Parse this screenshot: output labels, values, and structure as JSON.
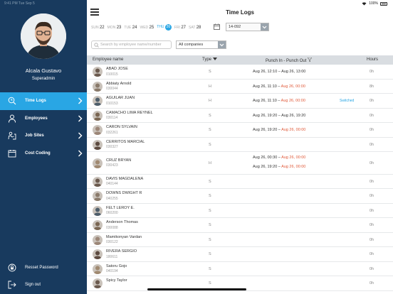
{
  "status_bar": {
    "time": "9:41 PM Tue Sep 5",
    "battery": "100%"
  },
  "user": {
    "name": "Alcala Gustavo",
    "role": "Superadmin"
  },
  "nav": [
    {
      "label": "Time Logs",
      "active": true
    },
    {
      "label": "Employees",
      "active": false
    },
    {
      "label": "Job Sites",
      "active": false
    },
    {
      "label": "Cost Coding",
      "active": false
    }
  ],
  "bottom_nav": {
    "reset": "Resset Password",
    "signout": "Sign out"
  },
  "header": {
    "title": "Time Logs"
  },
  "days": [
    {
      "name": "SUN",
      "num": "22"
    },
    {
      "name": "MON",
      "num": "23"
    },
    {
      "name": "TUE",
      "num": "24"
    },
    {
      "name": "WED",
      "num": "25"
    },
    {
      "name": "THU",
      "num": "26"
    },
    {
      "name": "FRI",
      "num": "27"
    },
    {
      "name": "SAT",
      "num": "28"
    }
  ],
  "week_select": {
    "value": "14-092"
  },
  "search": {
    "placeholder": "Search by employee name/number"
  },
  "company_select": {
    "value": "All companies"
  },
  "table": {
    "headers": {
      "name": "Employee name",
      "type": "Type",
      "punch": "Punch In - Punch Out",
      "hours": "Hours"
    },
    "rows": [
      {
        "name": "ABAD JOSE",
        "id": "010015",
        "type": "S",
        "punches": [
          {
            "in": "Aug 26, 12:10",
            "out": "Aug 26, 13:00",
            "out_red": false
          }
        ],
        "status": "",
        "hours": "0h"
      },
      {
        "name": "Abbiaty Arnold",
        "id": "030044",
        "type": "H",
        "punches": [
          {
            "in": "Aug 26, 11:10",
            "out": "Aug 26, 00:00",
            "out_red": true
          }
        ],
        "status": "",
        "hours": "8h"
      },
      {
        "name": "AGUILAR JUAN",
        "id": "010153",
        "type": "H",
        "punches": [
          {
            "in": "Aug 26, 11:10",
            "out": "Aug 26, 00:00",
            "out_red": true
          }
        ],
        "status": "Switched",
        "hours": "0h"
      },
      {
        "name": "CAMACHO LIMA REYNEL",
        "id": "030114",
        "type": "S",
        "punches": [
          {
            "in": "Aug 26, 19:20",
            "out": "Aug 26, 19:20",
            "out_red": false
          }
        ],
        "status": "",
        "hours": "0h"
      },
      {
        "name": "CARON SYLVAIN",
        "id": "032261",
        "type": "S",
        "punches": [
          {
            "in": "Aug 26, 19:20",
            "out": "Aug 26, 00:00",
            "out_red": true
          }
        ],
        "status": "",
        "hours": "0h"
      },
      {
        "name": "CERRITOS MARCIAL",
        "id": "030327",
        "type": "S",
        "punches": [],
        "status": "",
        "hours": "0h"
      },
      {
        "name": "CRUZ BRYAN",
        "id": "030423",
        "type": "H",
        "punches": [
          {
            "in": "Aug 26, 00:30",
            "out": "Aug 26, 00:00",
            "out_red": true
          },
          {
            "in": "Aug 26, 19:20",
            "out": "Aug 26, 00:00",
            "out_red": true
          }
        ],
        "status": "",
        "hours": "0h"
      },
      {
        "name": "DAVIS MAGDALENA",
        "id": "040144",
        "type": "S",
        "punches": [],
        "status": "",
        "hours": "0h"
      },
      {
        "name": "DOWNS DWIGHT R",
        "id": "040255",
        "type": "S",
        "punches": [],
        "status": "",
        "hours": "0h"
      },
      {
        "name": "FELT LEROY E.",
        "id": "060200",
        "type": "S",
        "punches": [],
        "status": "",
        "hours": "0h"
      },
      {
        "name": "Anderson Thomas",
        "id": "030088",
        "type": "S",
        "punches": [],
        "status": "",
        "hours": "0h"
      },
      {
        "name": "Mamikonyan Vardan",
        "id": "030122",
        "type": "S",
        "punches": [],
        "status": "",
        "hours": "0h"
      },
      {
        "name": "RIVERA SERGIO",
        "id": "180611",
        "type": "S",
        "punches": [],
        "status": "",
        "hours": "0h"
      },
      {
        "name": "Satoru Gojo",
        "id": "040194",
        "type": "S",
        "punches": [],
        "status": "",
        "hours": "0h"
      },
      {
        "name": "Spicy Taylor",
        "id": "",
        "type": "S",
        "punches": [],
        "status": "",
        "hours": "0h"
      }
    ]
  },
  "colors": {
    "sidebar": "#183a5e",
    "accent": "#29a6e4",
    "red": "#e05a3a",
    "header_bg": "#d9dde1"
  }
}
